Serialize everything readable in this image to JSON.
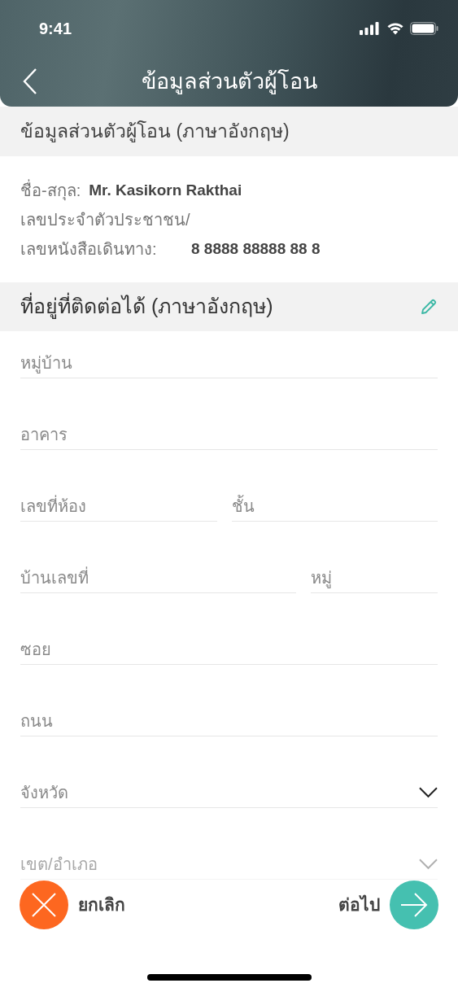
{
  "status_bar": {
    "time": "9:41"
  },
  "nav": {
    "title": "ข้อมูลส่วนตัวผู้โอน"
  },
  "personal_section": {
    "title": "ข้อมูลส่วนตัวผู้โอน (ภาษาอังกฤษ)",
    "rows": [
      {
        "label": "ชื่อ-สกุล:",
        "value": "Mr. Kasikorn Rakthai"
      },
      {
        "label": "เลขประจำตัวประชาชน/",
        "value": ""
      },
      {
        "label": "เลขหนังสือเดินทาง:",
        "value": "8 8888 88888 88 8"
      }
    ]
  },
  "address_section": {
    "title": "ที่อยู่ที่ติดต่อได้ (ภาษาอังกฤษ)",
    "rows": [
      [
        {
          "placeholder": "หมู่บ้าน",
          "kind": "text",
          "disabled": false
        }
      ],
      [
        {
          "placeholder": "อาคาร",
          "kind": "text",
          "disabled": false
        }
      ],
      [
        {
          "placeholder": "เลขที่ห้อง",
          "kind": "text",
          "disabled": false
        },
        {
          "placeholder": "ชั้น",
          "kind": "text",
          "disabled": false
        }
      ],
      [
        {
          "placeholder": "บ้านเลขที่",
          "kind": "text",
          "disabled": false
        },
        {
          "placeholder": "หมู่",
          "kind": "text",
          "disabled": false
        }
      ],
      [
        {
          "placeholder": "ซอย",
          "kind": "text",
          "disabled": false
        }
      ],
      [
        {
          "placeholder": "ถนน",
          "kind": "text",
          "disabled": false
        }
      ],
      [
        {
          "placeholder": "จังหวัด",
          "kind": "dropdown",
          "disabled": false
        }
      ],
      [
        {
          "placeholder": "เขต/อำเภอ",
          "kind": "dropdown",
          "disabled": true
        }
      ]
    ]
  },
  "actions": {
    "cancel": "ยกเลิก",
    "next": "ต่อไป"
  }
}
